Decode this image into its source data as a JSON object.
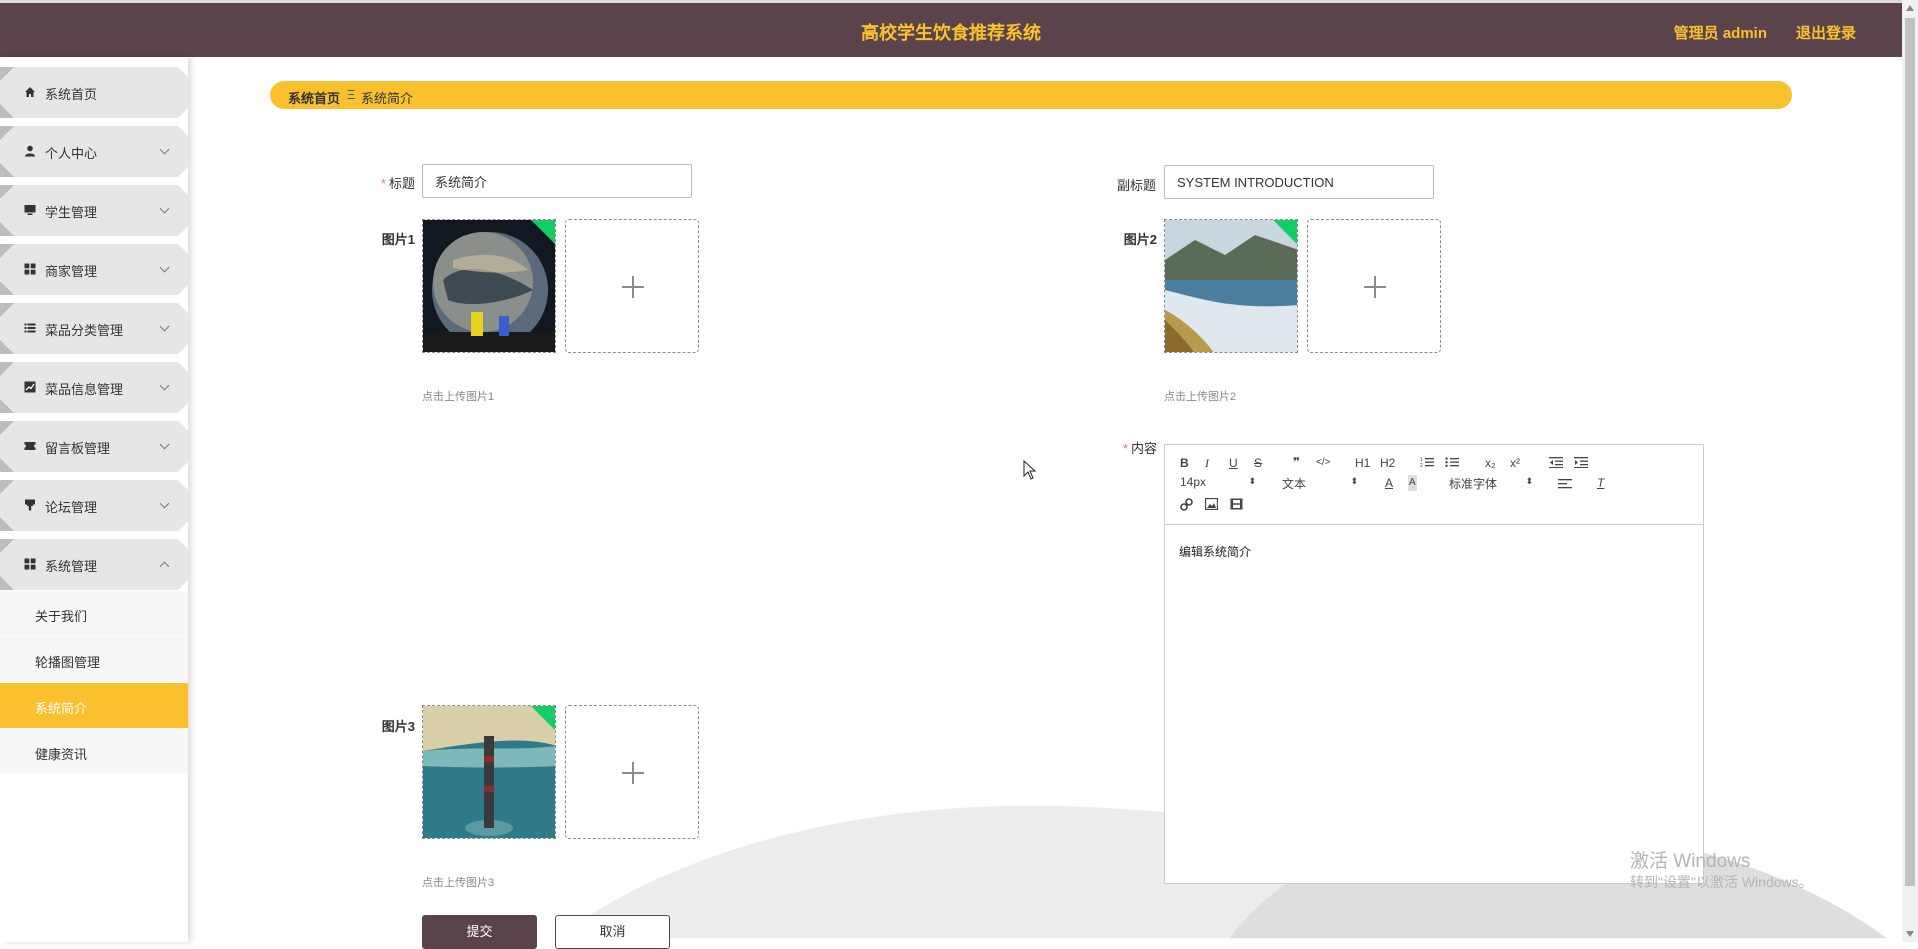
{
  "header": {
    "title": "高校学生饮食推荐系统",
    "user": "管理员 admin",
    "logout": "退出登录",
    "bg_color": "#5b434b",
    "accent_color": "#fbc02d"
  },
  "sidebar": {
    "items": [
      {
        "label": "系统首页",
        "icon": "home-icon",
        "has_arrow": false
      },
      {
        "label": "个人中心",
        "icon": "user-icon",
        "has_arrow": true
      },
      {
        "label": "学生管理",
        "icon": "monitor-icon",
        "has_arrow": true
      },
      {
        "label": "商家管理",
        "icon": "grid-icon",
        "has_arrow": true
      },
      {
        "label": "菜品分类管理",
        "icon": "list-icon",
        "has_arrow": true
      },
      {
        "label": "菜品信息管理",
        "icon": "chart-icon",
        "has_arrow": true
      },
      {
        "label": "留言板管理",
        "icon": "ticket-icon",
        "has_arrow": true
      },
      {
        "label": "论坛管理",
        "icon": "brush-icon",
        "has_arrow": true
      },
      {
        "label": "系统管理",
        "icon": "grid-icon",
        "has_arrow": true,
        "expanded": true
      }
    ],
    "submenu": [
      {
        "label": "关于我们",
        "active": false
      },
      {
        "label": "轮播图管理",
        "active": false
      },
      {
        "label": "系统简介",
        "active": true
      },
      {
        "label": "健康资讯",
        "active": false
      }
    ]
  },
  "breadcrumb": {
    "home": "系统首页",
    "separator": "Ξ",
    "current": "系统简介"
  },
  "form": {
    "title_label": "标题",
    "title_value": "系统简介",
    "subtitle_label": "副标题",
    "subtitle_value": "SYSTEM INTRODUCTION",
    "picture1_label": "图片1",
    "picture1_hint": "点击上传图片1",
    "picture2_label": "图片2",
    "picture2_hint": "点击上传图片2",
    "picture3_label": "图片3",
    "picture3_hint": "点击上传图片3",
    "content_label": "内容",
    "content_text": "编辑系统简介",
    "required_mark": "*",
    "submit": "提交",
    "cancel": "取消"
  },
  "editor_toolbar": {
    "row1": [
      "B",
      "I",
      "U",
      "S",
      "❞",
      "</>",
      "H1",
      "H2",
      "ol",
      "ul",
      "x₂",
      "x²",
      "outdent",
      "indent"
    ],
    "size": "14px",
    "header": "文本",
    "font": "标准字体"
  },
  "watermark": {
    "line1": "激活 Windows",
    "line2": "转到\"设置\"以激活 Windows。"
  }
}
